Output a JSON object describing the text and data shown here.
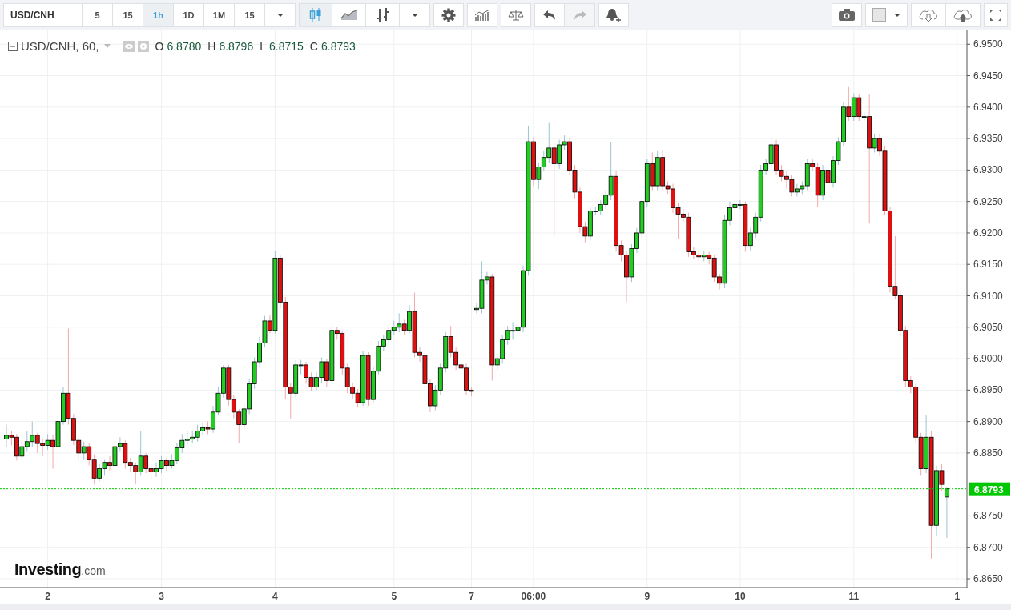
{
  "toolbar": {
    "symbol": "USD/CNH",
    "intervals": [
      {
        "label": "5",
        "selected": false
      },
      {
        "label": "15",
        "selected": false
      },
      {
        "label": "1h",
        "selected": true
      },
      {
        "label": "1D",
        "selected": false
      },
      {
        "label": "1M",
        "selected": false
      },
      {
        "label": "15",
        "selected": false
      }
    ],
    "chart_styles": [
      {
        "kind": "candles",
        "selected": true
      },
      {
        "kind": "line",
        "selected": false
      },
      {
        "kind": "bars",
        "selected": false
      }
    ],
    "undo": {
      "disabled": false
    },
    "redo": {
      "disabled": true
    }
  },
  "legend": {
    "title": "USD/CNH, 60,",
    "values": [
      {
        "label": "O",
        "value": "6.8780"
      },
      {
        "label": "H",
        "value": "6.8796"
      },
      {
        "label": "L",
        "value": "6.8715"
      },
      {
        "label": "C",
        "value": "6.8793"
      }
    ]
  },
  "chart_data": {
    "type": "candlestick",
    "grid": true,
    "categories": [
      null,
      null,
      null,
      null,
      null,
      null,
      null,
      null,
      "2",
      null,
      null,
      null,
      null,
      null,
      null,
      null,
      null,
      null,
      null,
      null,
      null,
      null,
      null,
      null,
      null,
      null,
      null,
      null,
      null,
      null,
      "3",
      null,
      null,
      null,
      null,
      null,
      null,
      null,
      null,
      null,
      null,
      null,
      null,
      null,
      null,
      null,
      null,
      null,
      null,
      null,
      null,
      null,
      "4",
      null,
      null,
      null,
      null,
      null,
      null,
      null,
      null,
      null,
      null,
      null,
      null,
      null,
      null,
      null,
      null,
      null,
      null,
      null,
      null,
      null,
      null,
      "5",
      null,
      null,
      null,
      null,
      null,
      null,
      null,
      null,
      null,
      null,
      null,
      null,
      null,
      null,
      "7",
      null,
      null,
      null,
      null,
      null,
      null,
      null,
      null,
      null,
      null,
      null,
      "06:00",
      null,
      null,
      null,
      null,
      null,
      null,
      null,
      null,
      null,
      null,
      null,
      null,
      null,
      null,
      null,
      null,
      null,
      null,
      null,
      null,
      null,
      "9",
      null,
      null,
      null,
      null,
      null,
      null,
      null,
      null,
      null,
      null,
      null,
      null,
      null,
      null,
      null,
      null,
      null,
      "10",
      null,
      null,
      null,
      null,
      null,
      null,
      null,
      null,
      null,
      null,
      null,
      null,
      null,
      null,
      null,
      null,
      null,
      null,
      null,
      null,
      null,
      "11",
      null,
      null,
      null,
      null,
      null,
      null,
      null,
      null,
      null,
      null,
      null,
      null,
      null,
      null,
      null,
      null,
      null,
      null,
      null,
      "1"
    ],
    "ylim": [
      6.8636,
      6.9522
    ],
    "ref_lines": [
      {
        "axis": "y",
        "value": 6.8793,
        "color": "#00c800",
        "label": "6.8793"
      }
    ],
    "yticks": [
      {
        "value": 6.95,
        "label": "6.9500"
      },
      {
        "value": 6.945,
        "label": "6.9450"
      },
      {
        "value": 6.94,
        "label": "6.9400"
      },
      {
        "value": 6.935,
        "label": "6.9350"
      },
      {
        "value": 6.93,
        "label": "6.9300"
      },
      {
        "value": 6.925,
        "label": "6.9250"
      },
      {
        "value": 6.92,
        "label": "6.9200"
      },
      {
        "value": 6.915,
        "label": "6.9150"
      },
      {
        "value": 6.91,
        "label": "6.9100"
      },
      {
        "value": 6.905,
        "label": "6.9050"
      },
      {
        "value": 6.9,
        "label": "6.9000"
      },
      {
        "value": 6.895,
        "label": "6.8950"
      },
      {
        "value": 6.89,
        "label": "6.8900"
      },
      {
        "value": 6.885,
        "label": "6.8850"
      },
      {
        "value": 6.875,
        "label": "6.8750"
      },
      {
        "value": 6.87,
        "label": "6.8700"
      },
      {
        "value": 6.865,
        "label": "6.8650"
      }
    ],
    "ohlc": [
      [
        6.8872,
        6.8895,
        6.886,
        6.8878
      ],
      [
        6.8878,
        6.8885,
        6.8862,
        6.8875
      ],
      [
        6.8875,
        6.888,
        6.8838,
        6.8845
      ],
      [
        6.8845,
        6.8868,
        6.884,
        6.886
      ],
      [
        6.886,
        6.8885,
        6.8852,
        6.8868
      ],
      [
        6.8868,
        6.89,
        6.886,
        6.8878
      ],
      [
        6.8878,
        6.8882,
        6.885,
        6.8865
      ],
      [
        6.8865,
        6.8872,
        6.8845,
        6.8862
      ],
      [
        6.8862,
        6.888,
        6.8855,
        6.887
      ],
      [
        6.887,
        6.8878,
        6.8825,
        6.886
      ],
      [
        6.886,
        6.891,
        6.8852,
        6.89
      ],
      [
        6.89,
        6.8955,
        6.8895,
        6.8945
      ],
      [
        6.8945,
        6.9048,
        6.8895,
        6.8905
      ],
      [
        6.8905,
        6.8912,
        6.8862,
        6.887
      ],
      [
        6.887,
        6.8878,
        6.8838,
        6.885
      ],
      [
        6.885,
        6.8868,
        6.884,
        6.886
      ],
      [
        6.886,
        6.8865,
        6.883,
        6.884
      ],
      [
        6.884,
        6.8848,
        6.88,
        6.881
      ],
      [
        6.881,
        6.8832,
        6.8805,
        6.8825
      ],
      [
        6.8825,
        6.884,
        6.8815,
        6.8835
      ],
      [
        6.8835,
        6.8845,
        6.8822,
        6.883
      ],
      [
        6.883,
        6.8868,
        6.8825,
        6.886
      ],
      [
        6.886,
        6.8875,
        6.8852,
        6.8865
      ],
      [
        6.8865,
        6.887,
        6.8825,
        6.8835
      ],
      [
        6.8835,
        6.8842,
        6.882,
        6.883
      ],
      [
        6.883,
        6.8835,
        6.88,
        6.882
      ],
      [
        6.882,
        6.8885,
        6.8815,
        6.8845
      ],
      [
        6.8845,
        6.885,
        6.8818,
        6.8825
      ],
      [
        6.8825,
        6.8832,
        6.8808,
        6.882
      ],
      [
        6.882,
        6.8835,
        6.8812,
        6.8825
      ],
      [
        6.8825,
        6.8845,
        6.8818,
        6.8838
      ],
      [
        6.8838,
        6.8842,
        6.8822,
        6.883
      ],
      [
        6.883,
        6.8848,
        6.8825,
        6.8838
      ],
      [
        6.8838,
        6.8865,
        6.8832,
        6.8858
      ],
      [
        6.8858,
        6.888,
        6.885,
        6.887
      ],
      [
        6.887,
        6.8885,
        6.8862,
        6.8872
      ],
      [
        6.8872,
        6.8885,
        6.8865,
        6.8875
      ],
      [
        6.8875,
        6.8895,
        6.8868,
        6.8885
      ],
      [
        6.8885,
        6.8898,
        6.8878,
        6.889
      ],
      [
        6.889,
        6.89,
        6.888,
        6.8888
      ],
      [
        6.8888,
        6.8925,
        6.8882,
        6.8915
      ],
      [
        6.8915,
        6.8955,
        6.891,
        6.8945
      ],
      [
        6.8945,
        6.899,
        6.8938,
        6.8985
      ],
      [
        6.8985,
        6.899,
        6.8925,
        6.8935
      ],
      [
        6.8935,
        6.8942,
        6.8905,
        6.8915
      ],
      [
        6.8915,
        6.892,
        6.8865,
        6.8895
      ],
      [
        6.8895,
        6.8928,
        6.8888,
        6.892
      ],
      [
        6.892,
        6.8968,
        6.8912,
        6.896
      ],
      [
        6.896,
        6.9002,
        6.8952,
        6.8995
      ],
      [
        6.8995,
        6.9035,
        6.8988,
        6.9025
      ],
      [
        6.9025,
        6.9068,
        6.9018,
        6.906
      ],
      [
        6.906,
        6.907,
        6.904,
        6.9045
      ],
      [
        6.9045,
        6.9172,
        6.904,
        6.916
      ],
      [
        6.916,
        6.9165,
        6.908,
        6.909
      ],
      [
        6.909,
        6.9098,
        6.8935,
        6.8955
      ],
      [
        6.8955,
        6.8962,
        6.8905,
        6.8945
      ],
      [
        6.8945,
        6.8998,
        6.8938,
        6.899
      ],
      [
        6.899,
        6.8998,
        6.8975,
        6.899
      ],
      [
        6.899,
        6.8995,
        6.896,
        6.897
      ],
      [
        6.897,
        6.8978,
        6.8948,
        6.8955
      ],
      [
        6.8955,
        6.8978,
        6.895,
        6.897
      ],
      [
        6.897,
        6.9002,
        6.8962,
        6.8995
      ],
      [
        6.8995,
        6.9,
        6.8955,
        6.8965
      ],
      [
        6.8965,
        6.9052,
        6.896,
        6.9045
      ],
      [
        6.9045,
        6.905,
        6.903,
        6.904
      ],
      [
        6.904,
        6.9045,
        6.8975,
        6.8985
      ],
      [
        6.8985,
        6.8992,
        6.8945,
        6.8955
      ],
      [
        6.8955,
        6.8962,
        6.8935,
        6.8945
      ],
      [
        6.8945,
        6.8952,
        6.8922,
        6.893
      ],
      [
        6.893,
        6.9012,
        6.8925,
        6.9005
      ],
      [
        6.9005,
        6.901,
        6.8925,
        6.8935
      ],
      [
        6.8935,
        6.8988,
        6.893,
        6.898
      ],
      [
        6.898,
        6.9028,
        6.8975,
        6.902
      ],
      [
        6.902,
        6.9038,
        6.9012,
        6.903
      ],
      [
        6.903,
        6.9052,
        6.9022,
        6.9045
      ],
      [
        6.9045,
        6.906,
        6.9038,
        6.905
      ],
      [
        6.905,
        6.9072,
        6.9042,
        6.9055
      ],
      [
        6.9055,
        6.9062,
        6.9038,
        6.9045
      ],
      [
        6.9045,
        6.9085,
        6.904,
        6.9075
      ],
      [
        6.9075,
        6.9105,
        6.9002,
        6.901
      ],
      [
        6.901,
        6.9018,
        6.8995,
        6.9005
      ],
      [
        6.9005,
        6.9012,
        6.8952,
        6.896
      ],
      [
        6.896,
        6.8968,
        6.8915,
        6.8925
      ],
      [
        6.8925,
        6.8958,
        6.8918,
        6.895
      ],
      [
        6.895,
        6.8992,
        6.8942,
        6.8985
      ],
      [
        6.8985,
        6.9042,
        6.8978,
        6.9035
      ],
      [
        6.9035,
        6.9052,
        6.9002,
        6.901
      ],
      [
        6.901,
        6.9018,
        6.8982,
        6.899
      ],
      [
        6.899,
        6.8998,
        6.8978,
        6.8985
      ],
      [
        6.8985,
        6.8992,
        6.8942,
        6.895
      ],
      [
        6.895,
        6.8955,
        6.894,
        6.8948
      ],
      [
        6.9078,
        6.9088,
        6.9072,
        6.908
      ],
      [
        6.908,
        6.9155,
        6.9072,
        6.9125
      ],
      [
        6.9125,
        6.9138,
        6.9118,
        6.913
      ],
      [
        6.913,
        6.9135,
        6.8965,
        6.899
      ],
      [
        6.899,
        6.9008,
        6.8982,
        6.9
      ],
      [
        6.9,
        6.9038,
        6.8992,
        6.903
      ],
      [
        6.903,
        6.9052,
        6.9022,
        6.9045
      ],
      [
        6.9045,
        6.9058,
        6.903,
        6.9045
      ],
      [
        6.9045,
        6.906,
        6.904,
        6.905
      ],
      [
        6.905,
        6.9148,
        6.9042,
        6.914
      ],
      [
        6.914,
        6.937,
        6.9132,
        6.9345
      ],
      [
        6.9345,
        6.9352,
        6.9275,
        6.9285
      ],
      [
        6.9285,
        6.9312,
        6.927,
        6.9305
      ],
      [
        6.9305,
        6.933,
        6.9298,
        6.932
      ],
      [
        6.932,
        6.9375,
        6.9312,
        6.9335
      ],
      [
        6.9335,
        6.9342,
        6.9195,
        6.931
      ],
      [
        6.931,
        6.9348,
        6.9302,
        6.934
      ],
      [
        6.934,
        6.9355,
        6.9332,
        6.9345
      ],
      [
        6.9345,
        6.9352,
        6.9292,
        6.93
      ],
      [
        6.93,
        6.9308,
        6.9255,
        6.9265
      ],
      [
        6.9265,
        6.9272,
        6.92,
        6.921
      ],
      [
        6.921,
        6.9218,
        6.9185,
        6.9195
      ],
      [
        6.9195,
        6.9242,
        6.9188,
        6.9235
      ],
      [
        6.9235,
        6.9242,
        6.9228,
        6.9235
      ],
      [
        6.9235,
        6.9252,
        6.9228,
        6.9245
      ],
      [
        6.9245,
        6.9268,
        6.9238,
        6.926
      ],
      [
        6.926,
        6.9345,
        6.9252,
        6.929
      ],
      [
        6.929,
        6.9298,
        6.917,
        6.918
      ],
      [
        6.918,
        6.9188,
        6.9155,
        6.9165
      ],
      [
        6.9165,
        6.9172,
        6.909,
        6.913
      ],
      [
        6.913,
        6.9182,
        6.9122,
        6.9175
      ],
      [
        6.9175,
        6.9208,
        6.9168,
        6.92
      ],
      [
        6.92,
        6.9258,
        6.9192,
        6.925
      ],
      [
        6.925,
        6.9318,
        6.9242,
        6.931
      ],
      [
        6.931,
        6.9328,
        6.9268,
        6.9275
      ],
      [
        6.9275,
        6.933,
        6.9268,
        6.932
      ],
      [
        6.932,
        6.9332,
        6.9268,
        6.9275
      ],
      [
        6.9275,
        6.9282,
        6.9262,
        6.927
      ],
      [
        6.927,
        6.9278,
        6.9232,
        6.924
      ],
      [
        6.924,
        6.9248,
        6.919,
        6.923
      ],
      [
        6.923,
        6.9238,
        6.9218,
        6.9225
      ],
      [
        6.9225,
        6.9232,
        6.9162,
        6.917
      ],
      [
        6.917,
        6.9178,
        6.9158,
        6.9165
      ],
      [
        6.9165,
        6.9172,
        6.9155,
        6.9162
      ],
      [
        6.9162,
        6.9172,
        6.9155,
        6.9165
      ],
      [
        6.9165,
        6.917,
        6.915,
        6.916
      ],
      [
        6.916,
        6.9165,
        6.9122,
        6.913
      ],
      [
        6.913,
        6.9135,
        6.911,
        6.912
      ],
      [
        6.912,
        6.9228,
        6.9112,
        6.922
      ],
      [
        6.922,
        6.925,
        6.9212,
        6.924
      ],
      [
        6.924,
        6.9252,
        6.9232,
        6.9245
      ],
      [
        6.9245,
        6.9252,
        6.9238,
        6.9245
      ],
      [
        6.9245,
        6.925,
        6.917,
        6.918
      ],
      [
        6.918,
        6.9208,
        6.9172,
        6.92
      ],
      [
        6.92,
        6.9232,
        6.9192,
        6.9225
      ],
      [
        6.9225,
        6.9308,
        6.9218,
        6.93
      ],
      [
        6.93,
        6.9318,
        6.9292,
        6.931
      ],
      [
        6.931,
        6.9355,
        6.9302,
        6.934
      ],
      [
        6.934,
        6.9348,
        6.9292,
        6.93
      ],
      [
        6.93,
        6.9308,
        6.9282,
        6.929
      ],
      [
        6.929,
        6.9298,
        6.927,
        6.9285
      ],
      [
        6.9285,
        6.9292,
        6.9258,
        6.9265
      ],
      [
        6.9265,
        6.9278,
        6.9258,
        6.927
      ],
      [
        6.927,
        6.9282,
        6.9262,
        6.9275
      ],
      [
        6.9275,
        6.9318,
        6.9268,
        6.931
      ],
      [
        6.931,
        6.9318,
        6.9298,
        6.9305
      ],
      [
        6.9305,
        6.9312,
        6.9242,
        6.926
      ],
      [
        6.926,
        6.9308,
        6.9252,
        6.93
      ],
      [
        6.93,
        6.9308,
        6.9272,
        6.928
      ],
      [
        6.928,
        6.9322,
        6.9272,
        6.9315
      ],
      [
        6.9315,
        6.9352,
        6.9308,
        6.9345
      ],
      [
        6.9345,
        6.9408,
        6.9338,
        6.94
      ],
      [
        6.94,
        6.9432,
        6.9378,
        6.9385
      ],
      [
        6.9385,
        6.9422,
        6.9378,
        6.9415
      ],
      [
        6.9415,
        6.942,
        6.9378,
        6.9385
      ],
      [
        6.9385,
        6.9392,
        6.9378,
        6.9385
      ],
      [
        6.9385,
        6.942,
        6.9215,
        6.9335
      ],
      [
        6.9335,
        6.9358,
        6.9328,
        6.935
      ],
      [
        6.935,
        6.9358,
        6.9322,
        6.933
      ],
      [
        6.933,
        6.9338,
        6.9228,
        6.9235
      ],
      [
        6.9235,
        6.9242,
        6.9105,
        6.9115
      ],
      [
        6.9115,
        6.9195,
        6.9095,
        6.91
      ],
      [
        6.91,
        6.9108,
        6.9035,
        6.9045
      ],
      [
        6.9045,
        6.9052,
        6.8955,
        6.8965
      ],
      [
        6.8965,
        6.8972,
        6.8945,
        6.8955
      ],
      [
        6.8955,
        6.8962,
        6.8865,
        6.8875
      ],
      [
        6.8875,
        6.8882,
        6.8815,
        6.8825
      ],
      [
        6.8825,
        6.891,
        6.8818,
        6.8875
      ],
      [
        6.8875,
        6.8885,
        6.8682,
        6.8735
      ],
      [
        6.8735,
        6.883,
        6.8718,
        6.8822
      ],
      [
        6.8822,
        6.8832,
        6.879,
        6.88
      ],
      [
        6.878,
        6.8796,
        6.8715,
        6.8793
      ],
      null,
      null
    ]
  },
  "logo": {
    "name": "Investing",
    "suffix": ".com"
  }
}
